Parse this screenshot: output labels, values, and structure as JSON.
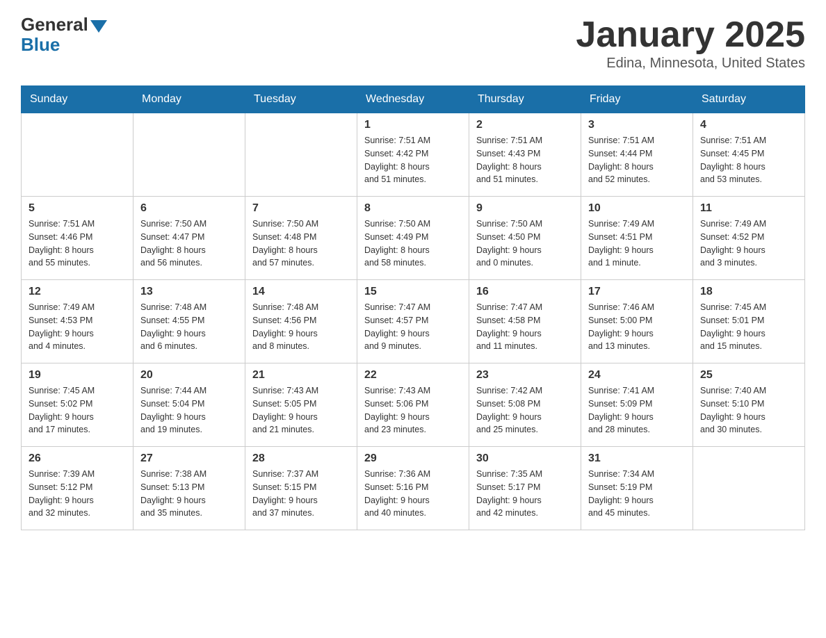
{
  "header": {
    "logo_general": "General",
    "logo_blue": "Blue",
    "month_title": "January 2025",
    "location": "Edina, Minnesota, United States"
  },
  "weekdays": [
    "Sunday",
    "Monday",
    "Tuesday",
    "Wednesday",
    "Thursday",
    "Friday",
    "Saturday"
  ],
  "weeks": [
    [
      {
        "day": "",
        "info": ""
      },
      {
        "day": "",
        "info": ""
      },
      {
        "day": "",
        "info": ""
      },
      {
        "day": "1",
        "info": "Sunrise: 7:51 AM\nSunset: 4:42 PM\nDaylight: 8 hours\nand 51 minutes."
      },
      {
        "day": "2",
        "info": "Sunrise: 7:51 AM\nSunset: 4:43 PM\nDaylight: 8 hours\nand 51 minutes."
      },
      {
        "day": "3",
        "info": "Sunrise: 7:51 AM\nSunset: 4:44 PM\nDaylight: 8 hours\nand 52 minutes."
      },
      {
        "day": "4",
        "info": "Sunrise: 7:51 AM\nSunset: 4:45 PM\nDaylight: 8 hours\nand 53 minutes."
      }
    ],
    [
      {
        "day": "5",
        "info": "Sunrise: 7:51 AM\nSunset: 4:46 PM\nDaylight: 8 hours\nand 55 minutes."
      },
      {
        "day": "6",
        "info": "Sunrise: 7:50 AM\nSunset: 4:47 PM\nDaylight: 8 hours\nand 56 minutes."
      },
      {
        "day": "7",
        "info": "Sunrise: 7:50 AM\nSunset: 4:48 PM\nDaylight: 8 hours\nand 57 minutes."
      },
      {
        "day": "8",
        "info": "Sunrise: 7:50 AM\nSunset: 4:49 PM\nDaylight: 8 hours\nand 58 minutes."
      },
      {
        "day": "9",
        "info": "Sunrise: 7:50 AM\nSunset: 4:50 PM\nDaylight: 9 hours\nand 0 minutes."
      },
      {
        "day": "10",
        "info": "Sunrise: 7:49 AM\nSunset: 4:51 PM\nDaylight: 9 hours\nand 1 minute."
      },
      {
        "day": "11",
        "info": "Sunrise: 7:49 AM\nSunset: 4:52 PM\nDaylight: 9 hours\nand 3 minutes."
      }
    ],
    [
      {
        "day": "12",
        "info": "Sunrise: 7:49 AM\nSunset: 4:53 PM\nDaylight: 9 hours\nand 4 minutes."
      },
      {
        "day": "13",
        "info": "Sunrise: 7:48 AM\nSunset: 4:55 PM\nDaylight: 9 hours\nand 6 minutes."
      },
      {
        "day": "14",
        "info": "Sunrise: 7:48 AM\nSunset: 4:56 PM\nDaylight: 9 hours\nand 8 minutes."
      },
      {
        "day": "15",
        "info": "Sunrise: 7:47 AM\nSunset: 4:57 PM\nDaylight: 9 hours\nand 9 minutes."
      },
      {
        "day": "16",
        "info": "Sunrise: 7:47 AM\nSunset: 4:58 PM\nDaylight: 9 hours\nand 11 minutes."
      },
      {
        "day": "17",
        "info": "Sunrise: 7:46 AM\nSunset: 5:00 PM\nDaylight: 9 hours\nand 13 minutes."
      },
      {
        "day": "18",
        "info": "Sunrise: 7:45 AM\nSunset: 5:01 PM\nDaylight: 9 hours\nand 15 minutes."
      }
    ],
    [
      {
        "day": "19",
        "info": "Sunrise: 7:45 AM\nSunset: 5:02 PM\nDaylight: 9 hours\nand 17 minutes."
      },
      {
        "day": "20",
        "info": "Sunrise: 7:44 AM\nSunset: 5:04 PM\nDaylight: 9 hours\nand 19 minutes."
      },
      {
        "day": "21",
        "info": "Sunrise: 7:43 AM\nSunset: 5:05 PM\nDaylight: 9 hours\nand 21 minutes."
      },
      {
        "day": "22",
        "info": "Sunrise: 7:43 AM\nSunset: 5:06 PM\nDaylight: 9 hours\nand 23 minutes."
      },
      {
        "day": "23",
        "info": "Sunrise: 7:42 AM\nSunset: 5:08 PM\nDaylight: 9 hours\nand 25 minutes."
      },
      {
        "day": "24",
        "info": "Sunrise: 7:41 AM\nSunset: 5:09 PM\nDaylight: 9 hours\nand 28 minutes."
      },
      {
        "day": "25",
        "info": "Sunrise: 7:40 AM\nSunset: 5:10 PM\nDaylight: 9 hours\nand 30 minutes."
      }
    ],
    [
      {
        "day": "26",
        "info": "Sunrise: 7:39 AM\nSunset: 5:12 PM\nDaylight: 9 hours\nand 32 minutes."
      },
      {
        "day": "27",
        "info": "Sunrise: 7:38 AM\nSunset: 5:13 PM\nDaylight: 9 hours\nand 35 minutes."
      },
      {
        "day": "28",
        "info": "Sunrise: 7:37 AM\nSunset: 5:15 PM\nDaylight: 9 hours\nand 37 minutes."
      },
      {
        "day": "29",
        "info": "Sunrise: 7:36 AM\nSunset: 5:16 PM\nDaylight: 9 hours\nand 40 minutes."
      },
      {
        "day": "30",
        "info": "Sunrise: 7:35 AM\nSunset: 5:17 PM\nDaylight: 9 hours\nand 42 minutes."
      },
      {
        "day": "31",
        "info": "Sunrise: 7:34 AM\nSunset: 5:19 PM\nDaylight: 9 hours\nand 45 minutes."
      },
      {
        "day": "",
        "info": ""
      }
    ]
  ]
}
